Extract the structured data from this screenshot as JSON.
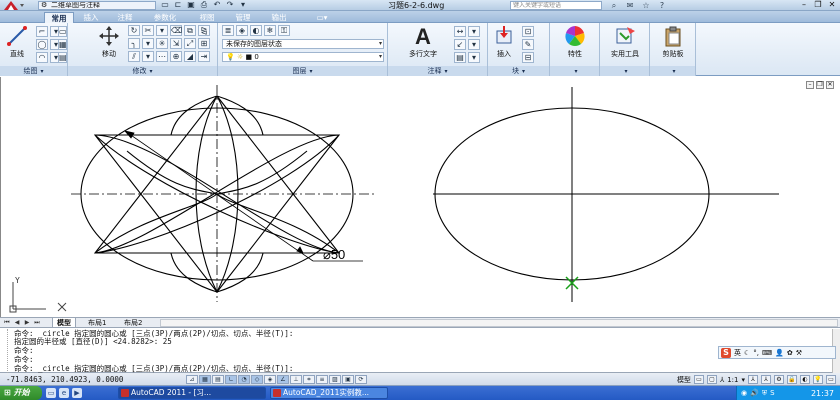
{
  "title_bar": {
    "workspace": "二维草图与注释",
    "document_title": "习题6-2-6.dwg",
    "search_placeholder": "键入关键字或短语"
  },
  "ribbon_tabs": [
    "常用",
    "插入",
    "注释",
    "参数化",
    "视图",
    "管理",
    "输出"
  ],
  "ribbon": {
    "draw": {
      "label": "绘图",
      "line_label": "直线"
    },
    "modify": {
      "label": "修改",
      "move_label": "移动"
    },
    "layers": {
      "label": "图层",
      "state_combo": "未保存的图层状态",
      "layer_combo": "0"
    },
    "annotation": {
      "label": "注释",
      "mtext_label": "多行文字"
    },
    "block": {
      "label": "块",
      "insert_label": "插入"
    },
    "properties": {
      "label": "特性"
    },
    "utilities": {
      "label": "实用工具"
    },
    "clipboard": {
      "label": "剪贴板"
    }
  },
  "drawing": {
    "dimension_text": "⌀50",
    "ucs_y": "Y",
    "ucs_x": "X"
  },
  "layout_tabs": [
    "模型",
    "布局1",
    "布局2"
  ],
  "command_lines": [
    "命令: _circle 指定圆的圆心或 [三点(3P)/两点(2P)/切点、切点、半径(T)]:",
    "指定圆的半径或 [直径(D)] <24.8282>: 25",
    "命令:",
    "命令:",
    "命令: _circle 指定圆的圆心或 [三点(3P)/两点(2P)/切点、切点、半径(T)]:"
  ],
  "ime": {
    "lang": "英"
  },
  "status_bar": {
    "coordinates": "-71.8463, 210.4923, 0.0000",
    "model_label": "模型",
    "scale": "1:1"
  },
  "taskbar": {
    "start_label": "开始",
    "tasks": [
      "AutoCAD 2011 - [习...",
      "AutoCAD_2011实例教..."
    ],
    "clock": "21:37"
  },
  "colors": {
    "ribbon_bg": "#dbe7f4",
    "tab_bar": "#9fbbdb",
    "taskbar": "#245ac4",
    "start": "#2f8a2a",
    "snap_marker": "#1aa01a"
  }
}
